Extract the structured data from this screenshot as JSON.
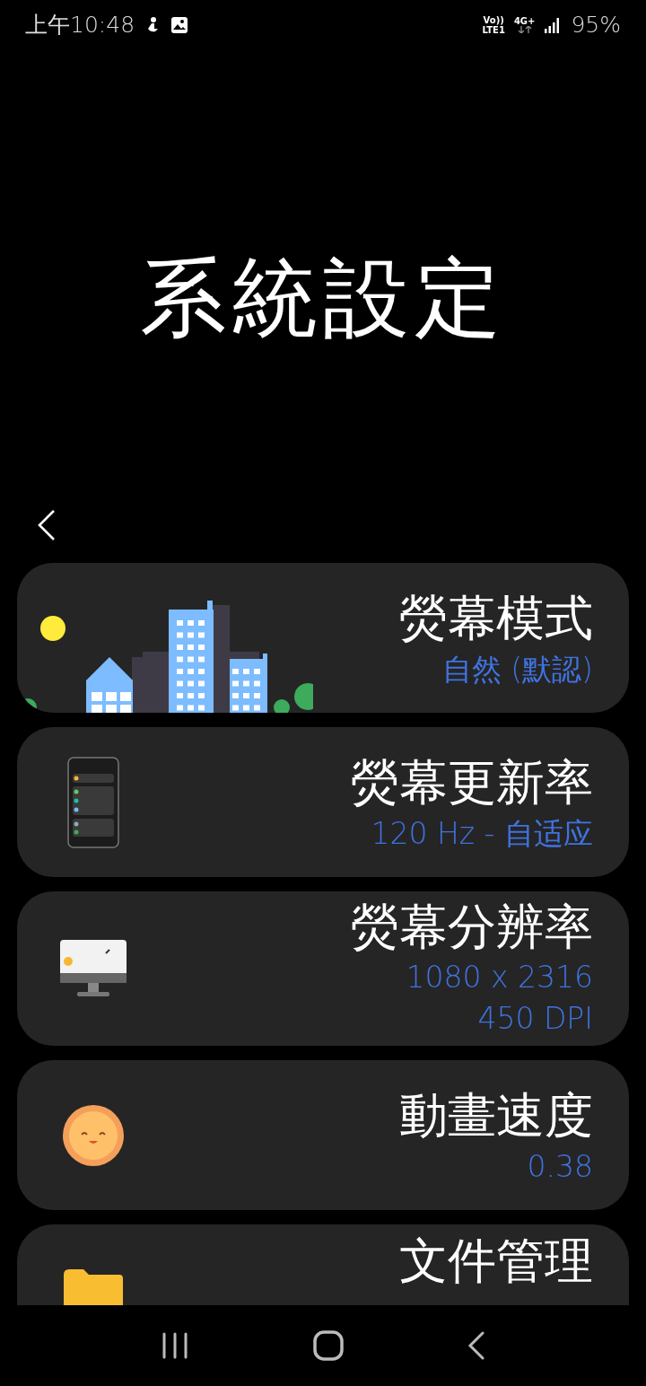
{
  "status_bar": {
    "time": "上午10:48",
    "volte_top": "Vo))",
    "volte_bottom": "LTE1",
    "network": "4G+",
    "battery": "95%"
  },
  "title": "系統設定",
  "cards": [
    {
      "kind": "city",
      "title": "熒幕模式",
      "lines": [
        "自然 (默認)"
      ]
    },
    {
      "kind": "phone",
      "title": "熒幕更新率",
      "lines": [
        "120 Hz - 自适应"
      ]
    },
    {
      "kind": "monitor",
      "title": "熒幕分辨率",
      "lines": [
        "1080 x 2316",
        "450 DPI"
      ]
    },
    {
      "kind": "sun",
      "title": "動畫速度",
      "lines": [
        "0.38"
      ]
    },
    {
      "kind": "folder",
      "title": "文件管理"
    }
  ]
}
